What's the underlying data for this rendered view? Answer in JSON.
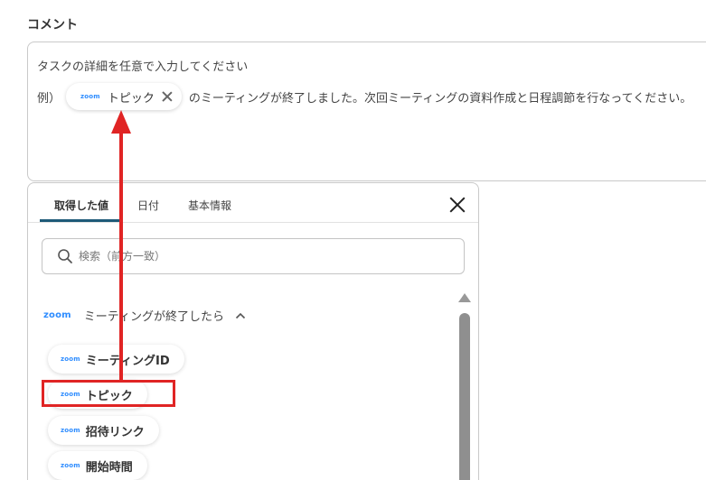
{
  "comment": {
    "label": "コメント",
    "line1": "タスクの詳細を任意で入力してください",
    "line2_prefix": "例）",
    "chip": {
      "logo": "zoom",
      "label": "トピック"
    },
    "line2_suffix": "のミーティングが終了しました。次回ミーティングの資料作成と日程調節を行なってください。"
  },
  "panel": {
    "tabs": [
      {
        "label": "取得した値",
        "active": true
      },
      {
        "label": "日付",
        "active": false
      },
      {
        "label": "基本情報",
        "active": false
      }
    ],
    "search": {
      "placeholder": "検索（前方一致）",
      "value": ""
    },
    "group": {
      "logo": "zoom",
      "title": "ミーティングが終了したら",
      "items": [
        {
          "logo": "zoom",
          "label": "ミーティングID"
        },
        {
          "logo": "zoom",
          "label": "トピック"
        },
        {
          "logo": "zoom",
          "label": "招待リンク"
        },
        {
          "logo": "zoom",
          "label": "開始時間"
        }
      ]
    }
  },
  "colors": {
    "accent": "#1e5a78",
    "zoom_blue": "#2d8cff",
    "annotation_red": "#e02424"
  }
}
